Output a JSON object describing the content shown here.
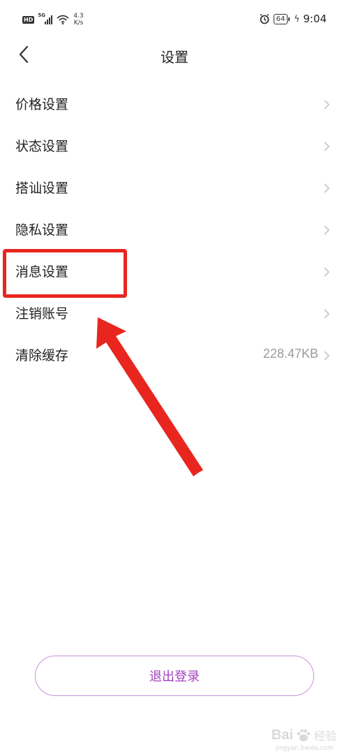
{
  "status_bar": {
    "hd": "HD",
    "network_type": "5G",
    "speed_value": "4.3",
    "speed_unit": "K/s",
    "battery": "64",
    "time": "9:04",
    "icons": [
      "signal-icon",
      "wifi-icon",
      "alarm-icon",
      "battery-icon",
      "charging-icon"
    ]
  },
  "header": {
    "title": "设置",
    "back_icon": "chevron-left-icon"
  },
  "settings": {
    "items": [
      {
        "label": "价格设置",
        "value": ""
      },
      {
        "label": "状态设置",
        "value": ""
      },
      {
        "label": "搭讪设置",
        "value": ""
      },
      {
        "label": "隐私设置",
        "value": ""
      },
      {
        "label": "消息设置",
        "value": ""
      },
      {
        "label": "注销账号",
        "value": ""
      },
      {
        "label": "清除缓存",
        "value": "228.47KB"
      }
    ]
  },
  "logout": {
    "label": "退出登录"
  },
  "annotation": {
    "highlighted_item": "消息设置",
    "color": "#e8261f"
  },
  "watermark": {
    "brand": "Bai",
    "brand_suffix": "经验",
    "url": "jingyan.baidu.com"
  },
  "colors": {
    "accent": "#a33fc0",
    "border": "#c693d8",
    "chevron": "#c8c8c8"
  }
}
